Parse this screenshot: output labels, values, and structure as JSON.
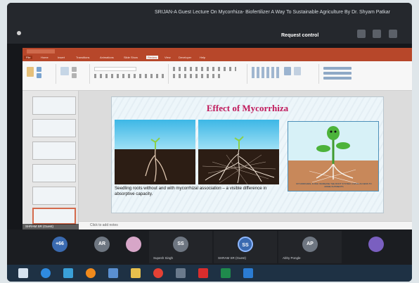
{
  "zoom": {
    "meeting_title": "SRIJAN-A Guest Lecture On Mycorrhiza- Biofertilizer A Way To Sustainable Agriculture By Dr. Shyam Patkar",
    "request_control": "Request control"
  },
  "powerpoint": {
    "ribbon_tabs": [
      "File",
      "Home",
      "Insert",
      "Transitions",
      "Animations",
      "Slide Show",
      "Review",
      "View",
      "Developer",
      "Help"
    ],
    "slide": {
      "title": "Effect of Mycorrhiza",
      "caption": "Seedling roots without and with mycorrhizal association – a visible difference in absorptive capacity.",
      "plant_caption": "MYCORRHIZAL FUNGI INCREASE THE ROOT SYSTEM, GIVING ACCESS TO MORE NUTRIENTS"
    },
    "notes_placeholder": "Click to add notes",
    "presenter_label": "SHRAM SR (Guest)"
  },
  "participants": [
    {
      "initials": "+66",
      "name": "",
      "color": "#3a6ab0"
    },
    {
      "initials": "AR",
      "name": "",
      "color": "#6e7681"
    },
    {
      "initials": "",
      "name": "",
      "color": "#d7a6c8"
    },
    {
      "initials": "SS",
      "name": "Supesh Singh",
      "color": "#6e7681"
    },
    {
      "initials": "SS",
      "name": "SHRAM SR (Guest)",
      "color": "#3a6ab0"
    },
    {
      "initials": "AP",
      "name": "Abhy Pongle",
      "color": "#6e7681"
    },
    {
      "initials": "",
      "name": "",
      "color": "#7a5fc0"
    }
  ],
  "colors": {
    "ppt_accent": "#b7472a",
    "slide_title": "#c0185a",
    "zoom_bg": "#1b1d21"
  },
  "taskbar_icons": [
    "windows-icon",
    "edge-icon",
    "monitor-icon",
    "firefox-icon",
    "mail-icon",
    "folder-icon",
    "chrome-icon",
    "store-icon",
    "pdf-icon",
    "excel-icon",
    "app-icon"
  ]
}
